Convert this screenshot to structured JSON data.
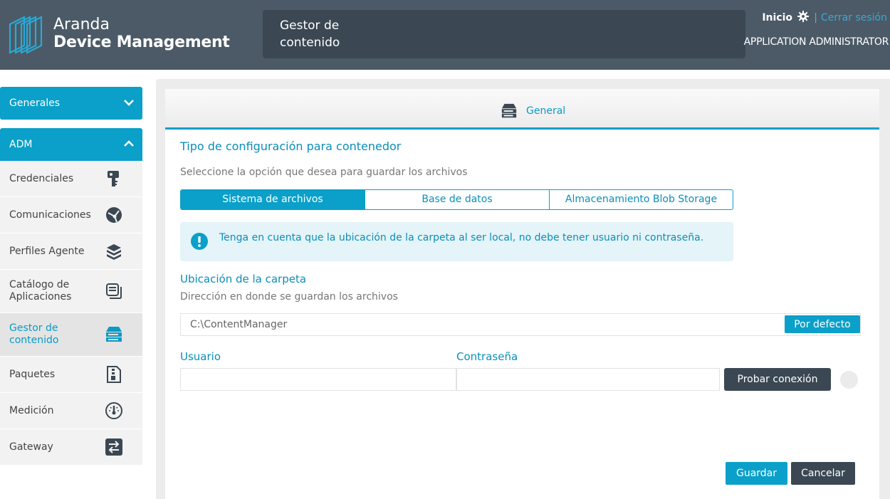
{
  "header": {
    "brand_line1": "Aranda",
    "brand_line2": "Device Management",
    "module_title": "Gestor de contenido",
    "home_label": "Inicio",
    "separator": "|",
    "logout_label": "Cerrar sesión",
    "user_role": "APPLICATION ADMINISTRATOR"
  },
  "sidebar": {
    "sections": [
      {
        "label": "Generales",
        "state": "collapsed"
      },
      {
        "label": "ADM",
        "state": "expanded"
      }
    ],
    "items": [
      {
        "label": "Credenciales",
        "icon": "key-icon"
      },
      {
        "label": "Comunicaciones",
        "icon": "communications-icon"
      },
      {
        "label": "Perfiles Agente",
        "icon": "agent-profiles-icon"
      },
      {
        "label": "Catálogo de Aplicaciones",
        "icon": "app-catalog-icon"
      },
      {
        "label": "Gestor de contenido",
        "icon": "content-manager-icon",
        "active": true
      },
      {
        "label": "Paquetes",
        "icon": "packages-icon"
      },
      {
        "label": "Medición",
        "icon": "gauge-icon"
      },
      {
        "label": "Gateway",
        "icon": "gateway-icon"
      }
    ]
  },
  "main": {
    "tab_label": "General",
    "section_title": "Tipo de configuración para contenedor",
    "section_subtitle": "Seleccione la opción que desea para guardar los archivos",
    "storage_options": [
      "Sistema de archivos",
      "Base de datos",
      "Almacenamiento Blob Storage"
    ],
    "selected_option": "Sistema de archivos",
    "info_message": "Tenga en cuenta que la ubicación de la carpeta al ser local, no debe tener usuario ni contraseña.",
    "folder_label": "Ubicación de la carpeta",
    "folder_help": "Dirección en donde se guardan los archivos",
    "folder_value": "C:\\ContentManager",
    "default_button": "Por defecto",
    "user_label": "Usuario",
    "user_value": "",
    "password_label": "Contraseña",
    "password_value": "",
    "test_button": "Probar conexión",
    "save_button": "Guardar",
    "cancel_button": "Cancelar"
  },
  "colors": {
    "header_bg": "#4b5a66",
    "accent": "#0aa0c9",
    "dark_button": "#3b4853",
    "info_bg": "#e4f4f8"
  }
}
